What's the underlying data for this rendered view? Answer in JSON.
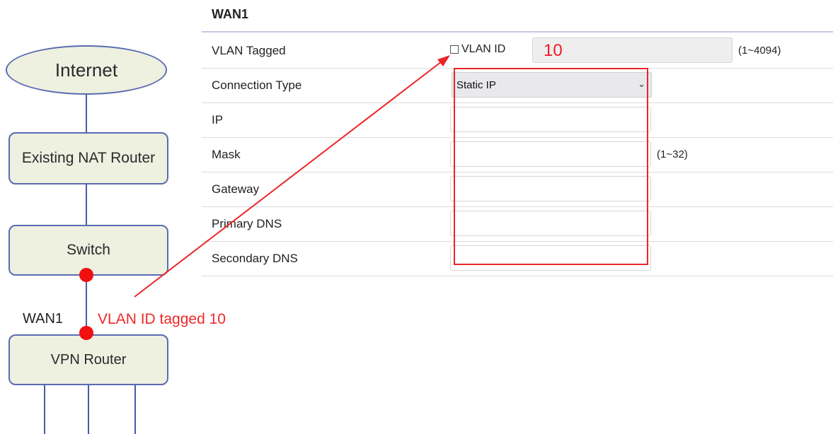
{
  "diagram": {
    "internet": "Internet",
    "existing_nat_router": "Existing NAT Router",
    "switch": "Switch",
    "vpn_router": "VPN Router",
    "wan_port_label": "WAN1",
    "vlan_annotation": "VLAN ID tagged 10"
  },
  "form": {
    "title": "WAN1",
    "rows": [
      {
        "label": "VLAN Tagged"
      },
      {
        "label": "Connection Type"
      },
      {
        "label": "IP"
      },
      {
        "label": "Mask"
      },
      {
        "label": "Gateway"
      },
      {
        "label": "Primary DNS"
      },
      {
        "label": "Secondary DNS"
      }
    ],
    "vlan_checkbox_label": "VLAN ID",
    "vlan_checked": false,
    "vlan_value": "10",
    "vlan_range": "(1~4094)",
    "connection_type_value": "Static IP",
    "mask_range": "(1~32)",
    "ip_value": "",
    "mask_value": "",
    "gateway_value": "",
    "primary_dns_value": "",
    "secondary_dns_value": ""
  },
  "colors": {
    "annotation_red": "#ec2428",
    "node_fill": "#eef0e0",
    "node_border": "#5a6bb0"
  },
  "icons": {
    "select_arrow": "chevron-down-icon",
    "checkbox": "checkbox-icon",
    "annotation_arrow": "arrow-icon"
  }
}
